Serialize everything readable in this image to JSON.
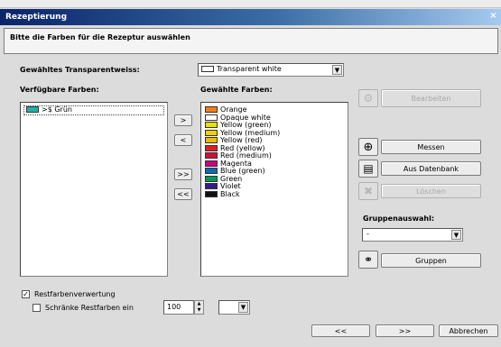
{
  "window": {
    "title": "Rezeptierung",
    "close_glyph": "×"
  },
  "banner": "Bitte die Farben für die Rezeptur auswählen",
  "transparent": {
    "label": "Gewähltes Transparentweiss:",
    "value": "Transparent white"
  },
  "available": {
    "label": "Verfügbare Farben:",
    "items": [
      {
        "label": ">$ Grün",
        "color": "#20b2aa"
      }
    ]
  },
  "selected": {
    "label": "Gewählte Farben:",
    "items": [
      {
        "label": "Orange",
        "color": "#f08020"
      },
      {
        "label": "Opaque white",
        "color": "#ffffff"
      },
      {
        "label": "Yellow (green)",
        "color": "#e8e000"
      },
      {
        "label": "Yellow (medium)",
        "color": "#f0d000"
      },
      {
        "label": "Yellow (red)",
        "color": "#f0b800"
      },
      {
        "label": "Red (yellow)",
        "color": "#e02020"
      },
      {
        "label": "Red (medium)",
        "color": "#cc1040"
      },
      {
        "label": "Magenta",
        "color": "#c80080"
      },
      {
        "label": "Blue (green)",
        "color": "#1068b0"
      },
      {
        "label": "Green",
        "color": "#009a60"
      },
      {
        "label": "Violet",
        "color": "#3a1a8a"
      },
      {
        "label": "Black",
        "color": "#111111"
      }
    ]
  },
  "transfer": {
    "add_one": ">",
    "remove_one": "<",
    "add_all": ">>",
    "remove_all": "<<"
  },
  "actions": {
    "edit": "Bearbeiten",
    "measure": "Messen",
    "from_db": "Aus Datenbank",
    "delete": "Löschen"
  },
  "group": {
    "label": "Gruppenauswahl:",
    "value": "-",
    "button": "Gruppen"
  },
  "options": {
    "leftover_label": "Restfarbenverwertung",
    "leftover_checked": "✓",
    "limit_label": "Schränke Restfarben ein",
    "limit_checked": "",
    "amount": "100"
  },
  "nav": {
    "back": "<<",
    "next": ">>",
    "cancel": "Abbrechen"
  }
}
